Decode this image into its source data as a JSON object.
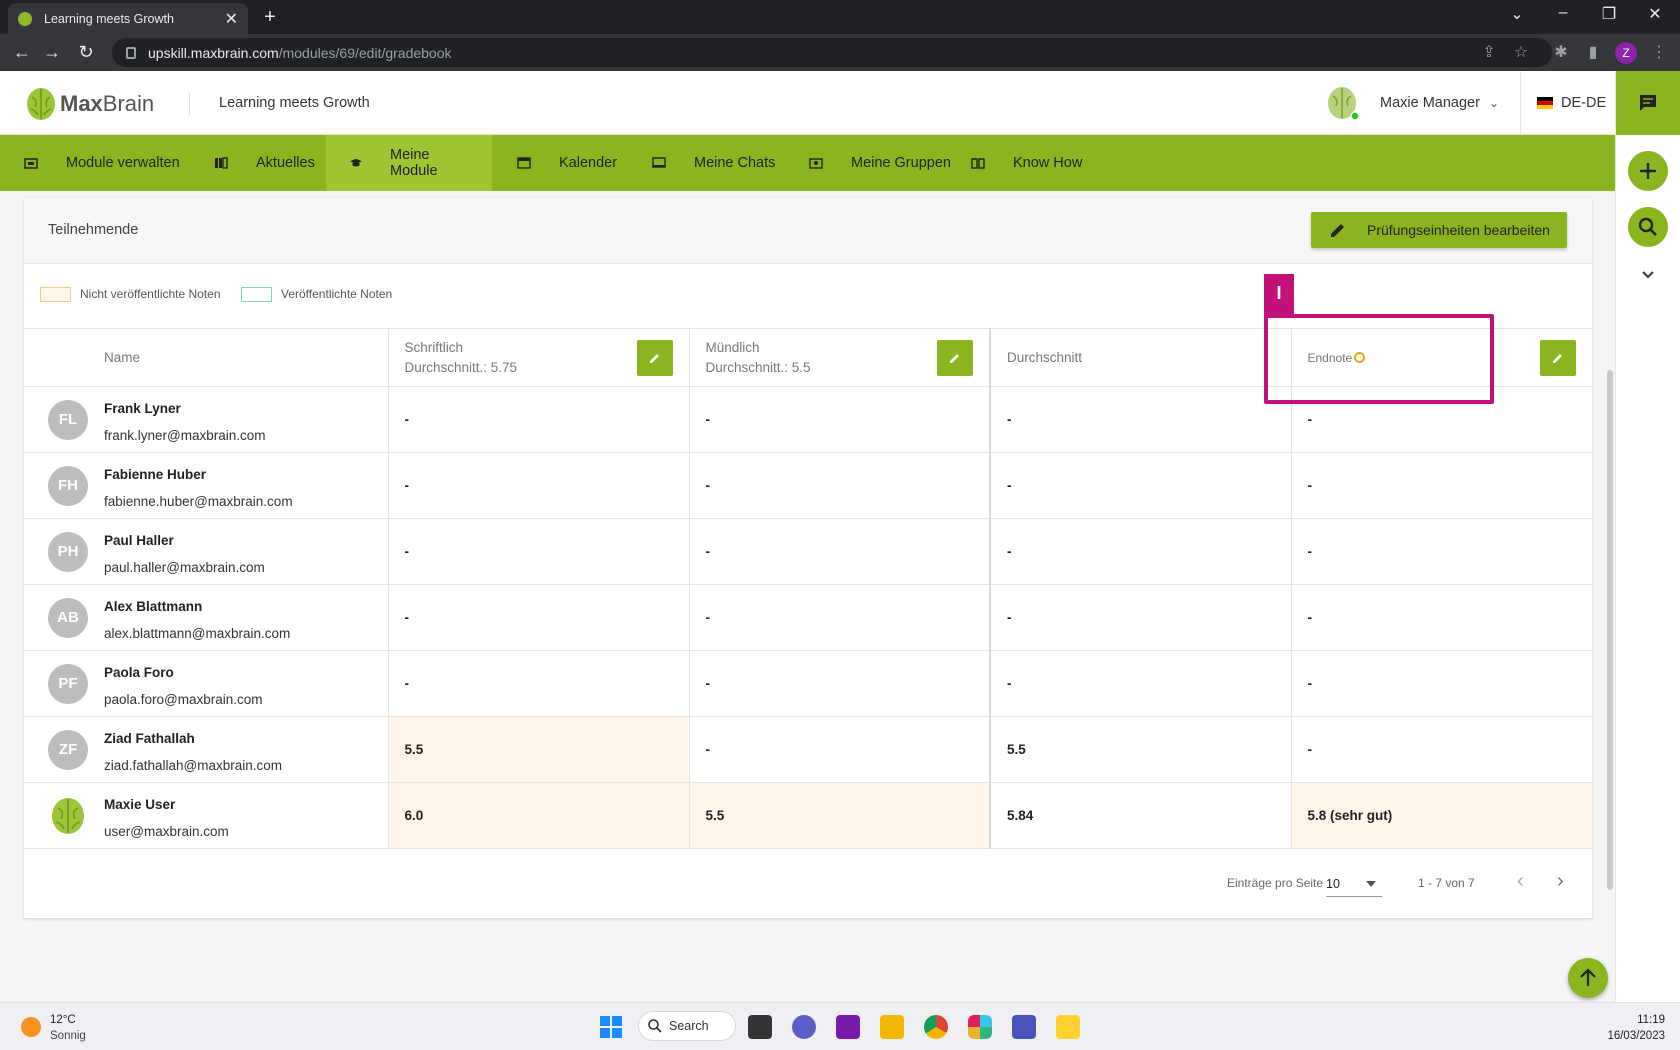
{
  "browser": {
    "tab_title": "Learning meets Growth",
    "url_host": "upskill.maxbrain.com",
    "url_path": "/modules/69/edit/gradebook",
    "profile_initial": "Z"
  },
  "header": {
    "logo_max": "Max",
    "logo_brain": "Brain",
    "tagline": "Learning meets Growth",
    "user_name": "Maxie Manager",
    "language": "DE-DE"
  },
  "nav": {
    "items": [
      {
        "label": "Module verwalten"
      },
      {
        "label": "Aktuelles"
      },
      {
        "label": "Meine Module"
      },
      {
        "label": "Kalender"
      },
      {
        "label": "Meine Chats"
      },
      {
        "label": "Meine Gruppen"
      },
      {
        "label": "Know How"
      }
    ]
  },
  "card": {
    "title": "Teilnehmende",
    "edit_button": "Prüfungseinheiten bearbeiten",
    "legend_unpublished": "Nicht veröffentlichte Noten",
    "legend_published": "Veröffentlichte Noten"
  },
  "colors": {
    "brand_green": "#8ab51e",
    "unpublished_fill": "#fef6ea",
    "unpublished_border": "#f7c98a",
    "published_border": "#7fd6c3",
    "highlight": "#c2127a"
  },
  "table": {
    "headers": {
      "name": "Name",
      "written": "Schriftlich",
      "written_avg": "Durchschnitt.: 5.75",
      "oral": "Mündlich",
      "oral_avg": "Durchschnitt.: 5.5",
      "average": "Durchschnitt",
      "final": "Endnote"
    },
    "rows": [
      {
        "initials": "FL",
        "name": "Frank Lyner",
        "email": "frank.lyner@maxbrain.com",
        "written": "-",
        "oral": "-",
        "average": "-",
        "final": "-"
      },
      {
        "initials": "FH",
        "name": "Fabienne Huber",
        "email": "fabienne.huber@maxbrain.com",
        "written": "-",
        "oral": "-",
        "average": "-",
        "final": "-"
      },
      {
        "initials": "PH",
        "name": "Paul Haller",
        "email": "paul.haller@maxbrain.com",
        "written": "-",
        "oral": "-",
        "average": "-",
        "final": "-"
      },
      {
        "initials": "AB",
        "name": "Alex Blattmann",
        "email": "alex.blattmann@maxbrain.com",
        "written": "-",
        "oral": "-",
        "average": "-",
        "final": "-"
      },
      {
        "initials": "PF",
        "name": "Paola Foro",
        "email": "paola.foro@maxbrain.com",
        "written": "-",
        "oral": "-",
        "average": "-",
        "final": "-"
      },
      {
        "initials": "ZF",
        "name": "Ziad Fathallah",
        "email": "ziad.fathallah@maxbrain.com",
        "written": "5.5",
        "oral": "-",
        "average": "5.5",
        "final": "-"
      },
      {
        "initials": "",
        "name": "Maxie User",
        "email": "user@maxbrain.com",
        "written": "6.0",
        "oral": "5.5",
        "average": "5.84",
        "final": "5.8 (sehr gut)"
      }
    ]
  },
  "highlight_label": "I",
  "pager": {
    "per_page_label": "Einträge pro Seite",
    "per_page_value": "10",
    "range": "1 - 7 von 7"
  },
  "taskbar": {
    "temp": "12°C",
    "condition": "Sonnig",
    "search": "Search",
    "time": "11:19",
    "date": "16/03/2023"
  }
}
